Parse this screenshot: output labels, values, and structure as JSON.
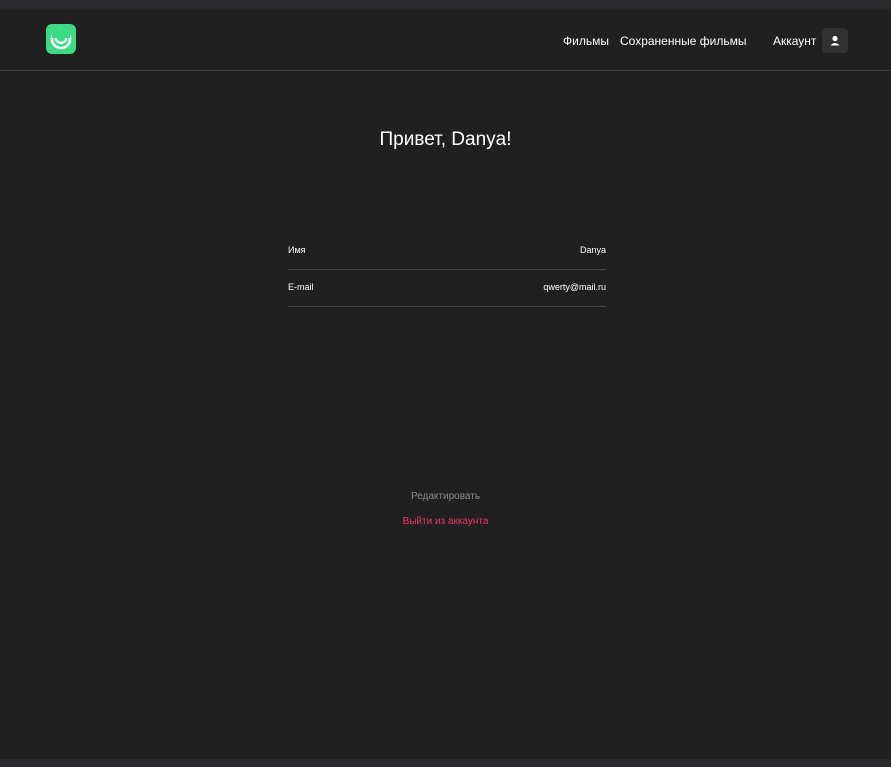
{
  "colors": {
    "page_background": "#202020",
    "accent": "#3ddc84",
    "danger": "#ee3465",
    "muted": "#8b8b8b",
    "divider": "#424242"
  },
  "header": {
    "logo_icon": "smile-icon",
    "nav": {
      "films": "Фильмы",
      "saved_films": "Сохраненные фильмы",
      "account": "Аккаунт"
    },
    "account_icon": "user-icon"
  },
  "profile": {
    "greeting": "Привет, Danya!",
    "fields": [
      {
        "label": "Имя",
        "value": "Danya"
      },
      {
        "label": "E-mail",
        "value": "qwerty@mail.ru"
      }
    ]
  },
  "actions": {
    "edit": "Редактировать",
    "logout": "Выйти из аккаунта"
  }
}
